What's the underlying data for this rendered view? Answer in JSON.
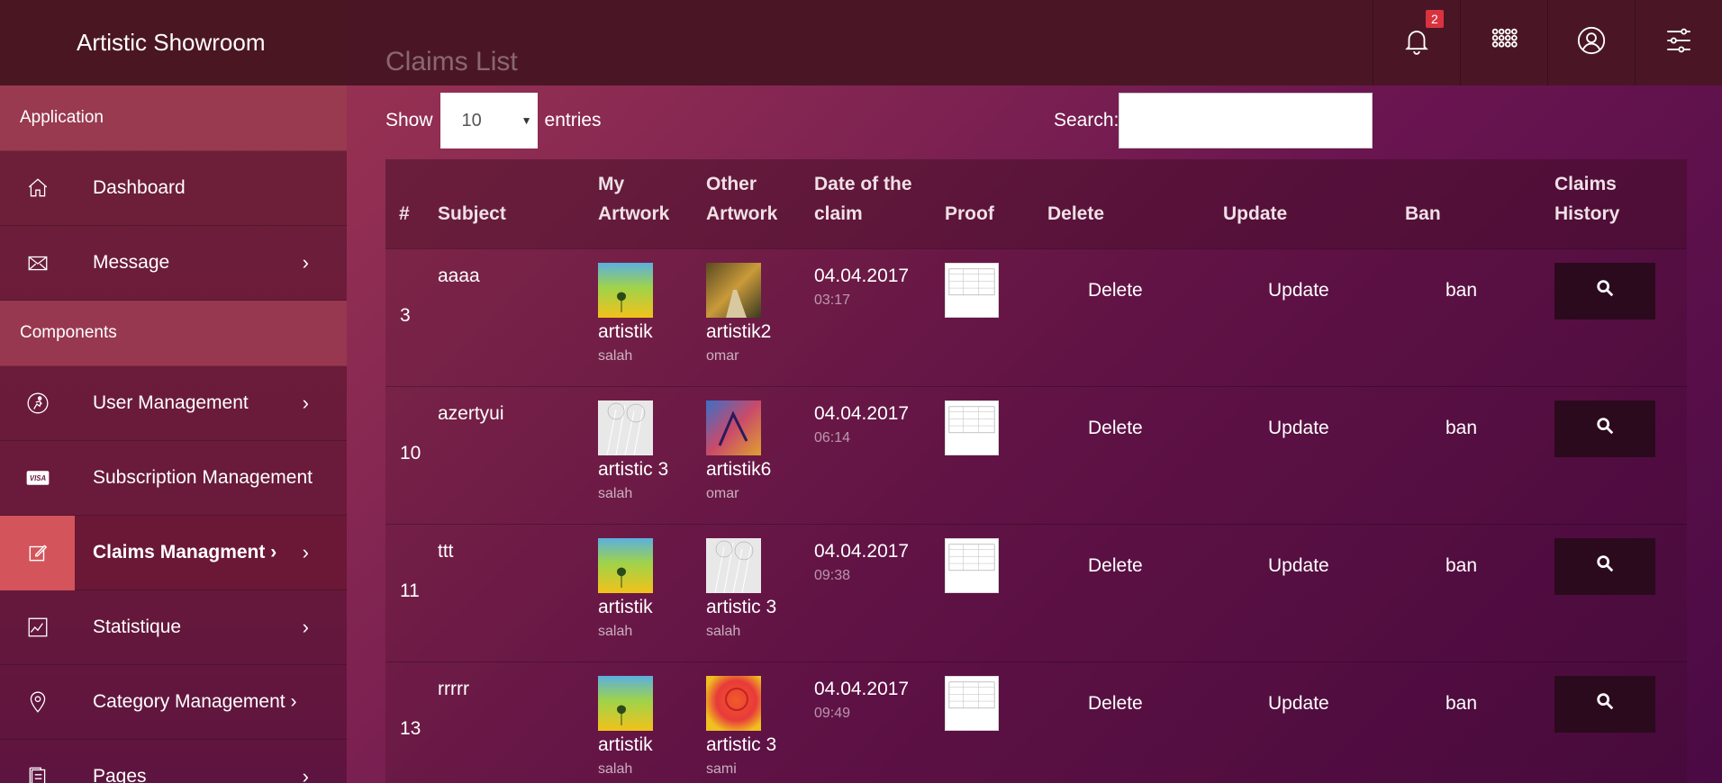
{
  "app": {
    "brand": "Artistic Showroom",
    "page_title": "Claims List"
  },
  "topbar": {
    "notification_count": "2"
  },
  "sidebar": {
    "sections": [
      "Application",
      "Components"
    ],
    "items": [
      {
        "label": "Dashboard",
        "icon": "home-icon",
        "chevron": ""
      },
      {
        "label": "Message",
        "icon": "envelope-icon",
        "chevron": "›"
      },
      {
        "label": "User Management",
        "icon": "user-run-icon",
        "chevron": "›"
      },
      {
        "label": "Subscription Management",
        "icon": "visa-icon",
        "chevron": ""
      },
      {
        "label": "Claims Managment ›",
        "icon": "edit-icon",
        "chevron": "›"
      },
      {
        "label": "Statistique",
        "icon": "chart-icon",
        "chevron": "›"
      },
      {
        "label": "Category Management ›",
        "icon": "map-pin-icon",
        "chevron": ""
      },
      {
        "label": "Pages",
        "icon": "pages-icon",
        "chevron": "›"
      }
    ]
  },
  "controls": {
    "show_label": "Show",
    "entries_value": "10",
    "entries_label": "entries",
    "search_label": "Search:",
    "search_value": ""
  },
  "table": {
    "headers": {
      "num": "#",
      "subject": "Subject",
      "my_artwork": "My Artwork",
      "other_artwork": "Other Artwork",
      "date": "Date of the claim",
      "proof": "Proof",
      "delete": "Delete",
      "update": "Update",
      "ban": "Ban",
      "history": "Claims History"
    },
    "rows": [
      {
        "num": "3",
        "subject": "aaaa",
        "my_art": "artistik",
        "my_user": "salah",
        "other_art": "artistik2",
        "other_user": "omar",
        "date": "04.04.2017",
        "time": "03:17",
        "delete": "Delete",
        "update": "Update",
        "ban": "ban"
      },
      {
        "num": "10",
        "subject": "azertyui",
        "my_art": "artistic 3",
        "my_user": "salah",
        "other_art": "artistik6",
        "other_user": "omar",
        "date": "04.04.2017",
        "time": "06:14",
        "delete": "Delete",
        "update": "Update",
        "ban": "ban"
      },
      {
        "num": "11",
        "subject": "ttt",
        "my_art": "artistik",
        "my_user": "salah",
        "other_art": "artistic 3",
        "other_user": "salah",
        "date": "04.04.2017",
        "time": "09:38",
        "delete": "Delete",
        "update": "Update",
        "ban": "ban"
      },
      {
        "num": "13",
        "subject": "rrrrr",
        "my_art": "artistik",
        "my_user": "salah",
        "other_art": "artistic 3",
        "other_user": "sami",
        "date": "04.04.2017",
        "time": "09:49",
        "delete": "Delete",
        "update": "Update",
        "ban": "ban"
      }
    ]
  }
}
